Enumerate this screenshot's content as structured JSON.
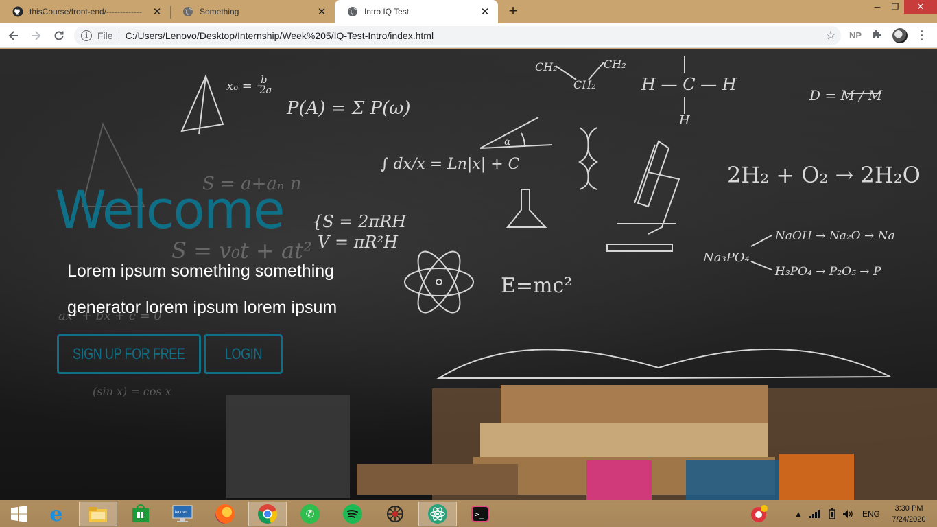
{
  "browser": {
    "tabs": [
      {
        "title": "thisCourse/front-end/-------------",
        "icon": "github-icon",
        "active": false
      },
      {
        "title": "Something",
        "icon": "globe-icon",
        "active": false
      },
      {
        "title": "Intro IQ Test",
        "icon": "globe-icon",
        "active": true
      }
    ],
    "new_tab_label": "+",
    "address": {
      "scheme": "File",
      "url": "C:/Users/Lenovo/Desktop/Internship/Week%205/IQ-Test-Intro/index.html"
    },
    "extension_label": "NP",
    "colors": {
      "tabbar": "#c9a46e",
      "active_tab": "#ffffff"
    }
  },
  "page": {
    "title": "Welcome",
    "tagline": "Lorem ipsum something something generator lorem ipsum lorem ipsum",
    "buttons": {
      "signup": "SIGN UP FOR FREE",
      "login": "LOGIN"
    },
    "colors": {
      "accent": "#0f6f86",
      "text": "#ffffff",
      "background": "#1d1d1d"
    }
  },
  "taskbar": {
    "apps": [
      "windows-start-icon",
      "internet-explorer-icon",
      "file-explorer-icon",
      "windows-store-icon",
      "lenovo-computer-icon",
      "firefox-icon",
      "chrome-icon",
      "whatsapp-icon",
      "spotify-icon",
      "spider-app-icon",
      "atom-icon",
      "terminal-icon"
    ],
    "language": "ENG",
    "time": "3:30 PM",
    "date": "7/24/2020"
  }
}
